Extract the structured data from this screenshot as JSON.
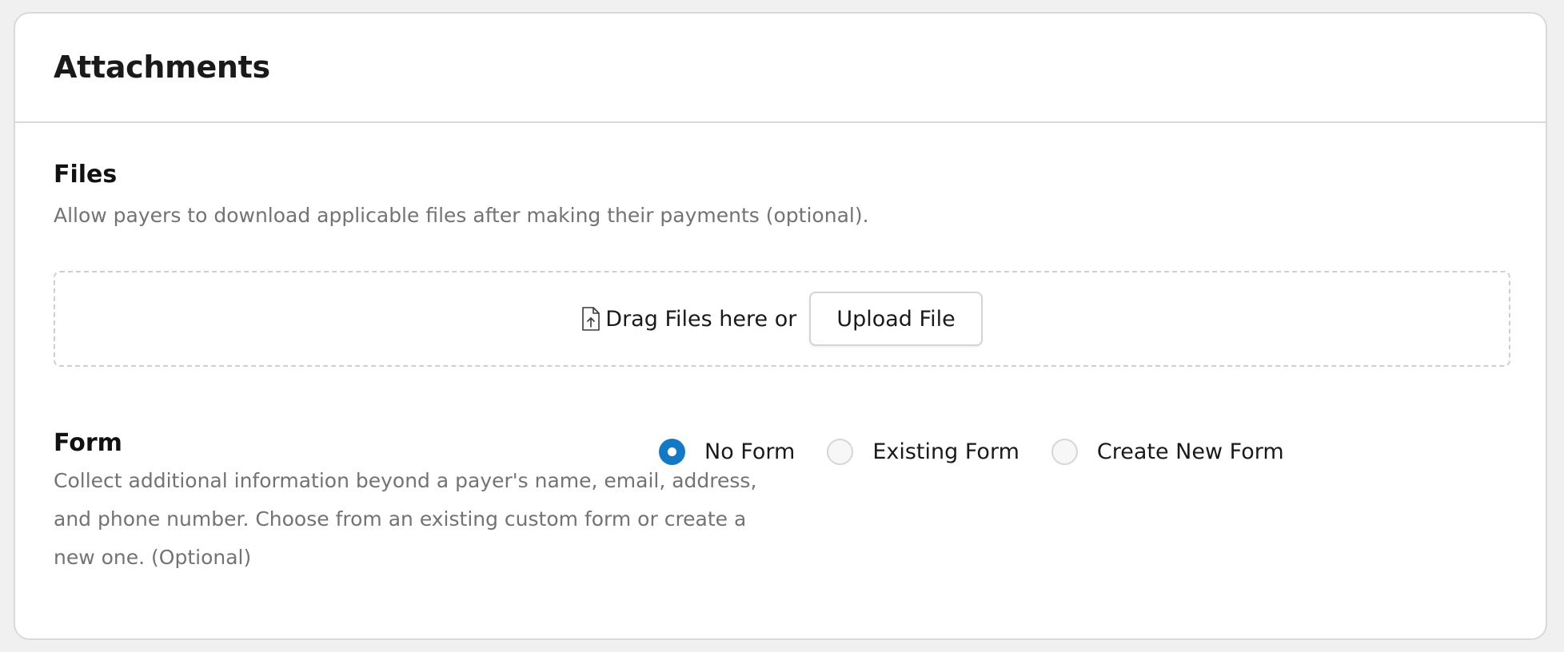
{
  "card": {
    "title": "Attachments"
  },
  "files": {
    "title": "Files",
    "description": "Allow payers to download applicable files after making their payments (optional).",
    "dropzone": {
      "icon": "file-upload-icon",
      "text": "Drag Files here or",
      "upload_label": "Upload File"
    }
  },
  "form": {
    "title": "Form",
    "description": "Collect additional information beyond a payer's name, email, address, and phone number. Choose from an existing custom form or create a new one. (Optional)",
    "options": [
      {
        "label": "No Form",
        "selected": true
      },
      {
        "label": "Existing Form",
        "selected": false
      },
      {
        "label": "Create New Form",
        "selected": false
      }
    ],
    "accent_color": "#1478c4"
  }
}
